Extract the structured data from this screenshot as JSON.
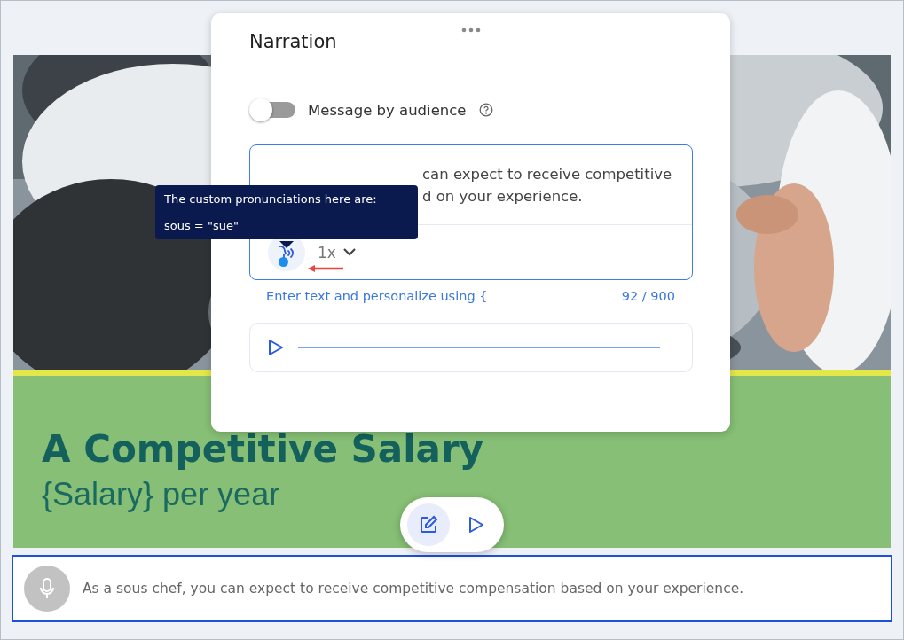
{
  "slide": {
    "heading": "A Competitive Salary",
    "subheading": "{Salary} per year"
  },
  "slide_toolbar": [
    {
      "kind": "edit",
      "selected": true
    },
    {
      "kind": "play",
      "selected": false
    }
  ],
  "caption": {
    "text": "As a sous chef, you can expect to receive competitive compensation based on your experience."
  },
  "narration": {
    "title": "Narration",
    "audience_toggle": {
      "label": "Message by audience",
      "on": false
    },
    "text_lines": [
      "can expect to receive competitive",
      "d on your experience."
    ],
    "custom_pronunciations": true,
    "tooltip": [
      "The custom pronunciations here are:",
      "sous = \"sue\""
    ],
    "speed": "1x",
    "helper": "Enter text and personalize using {",
    "counter": "92 / 900"
  }
}
